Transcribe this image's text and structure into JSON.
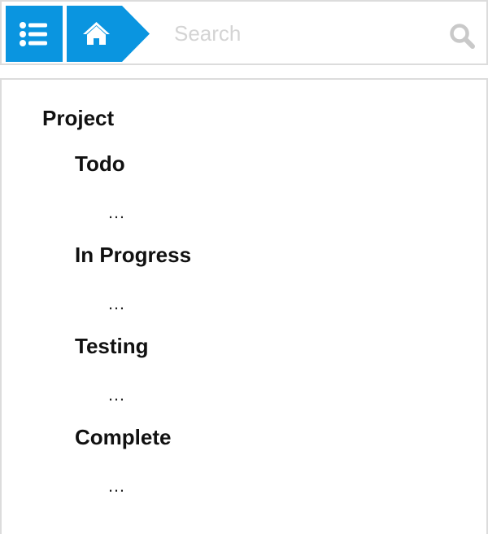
{
  "toolbar": {
    "accent_color": "#0a95e0",
    "list_button_icon": "list-icon",
    "home_button_icon": "home-icon",
    "search_placeholder": "Search",
    "search_value": "",
    "search_icon": "search-icon"
  },
  "tree": {
    "root_label": "Project",
    "nodes": [
      {
        "label": "Todo",
        "child_label": "…"
      },
      {
        "label": "In Progress",
        "child_label": "…"
      },
      {
        "label": "Testing",
        "child_label": "…"
      },
      {
        "label": "Complete",
        "child_label": "…"
      }
    ]
  }
}
